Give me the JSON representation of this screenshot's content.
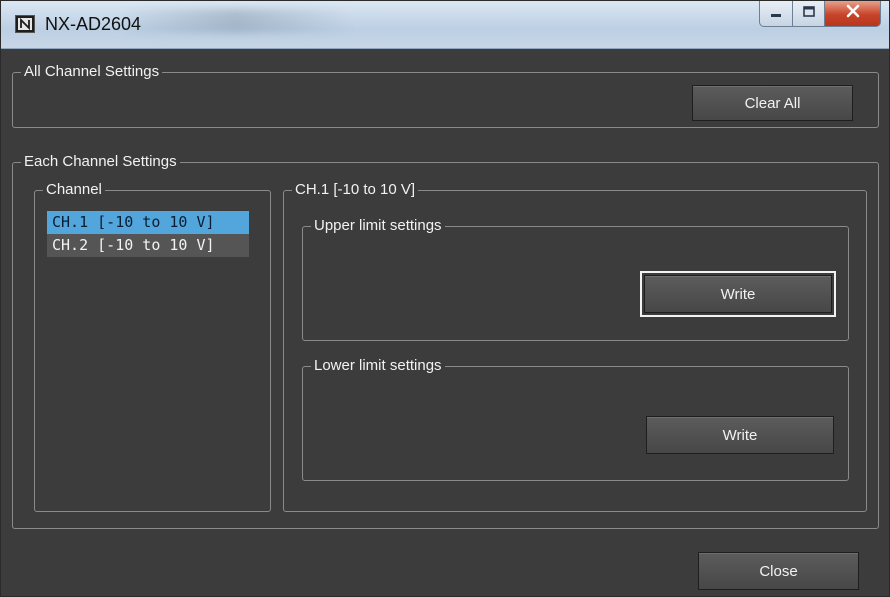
{
  "window": {
    "title": "NX-AD2604",
    "controls": {
      "minimize_icon": "minimize-icon",
      "maximize_icon": "maximize-icon",
      "close_icon": "close-icon"
    }
  },
  "all_channel": {
    "legend": "All Channel Settings",
    "clear_all_label": "Clear All"
  },
  "each_channel": {
    "legend": "Each Channel Settings",
    "channel_list": {
      "legend": "Channel",
      "items": [
        {
          "label": "CH.1  [-10 to 10 V]",
          "selected": true
        },
        {
          "label": "CH.2  [-10 to 10 V]",
          "selected": false
        }
      ]
    },
    "detail": {
      "legend": "CH.1  [-10 to 10 V]",
      "upper": {
        "legend": "Upper limit settings",
        "write_label": "Write"
      },
      "lower": {
        "legend": "Lower limit settings",
        "write_label": "Write"
      }
    }
  },
  "footer": {
    "close_label": "Close"
  },
  "colors": {
    "background": "#3c3c3c",
    "selection": "#52a6dc",
    "button": "#4f4f4f"
  }
}
